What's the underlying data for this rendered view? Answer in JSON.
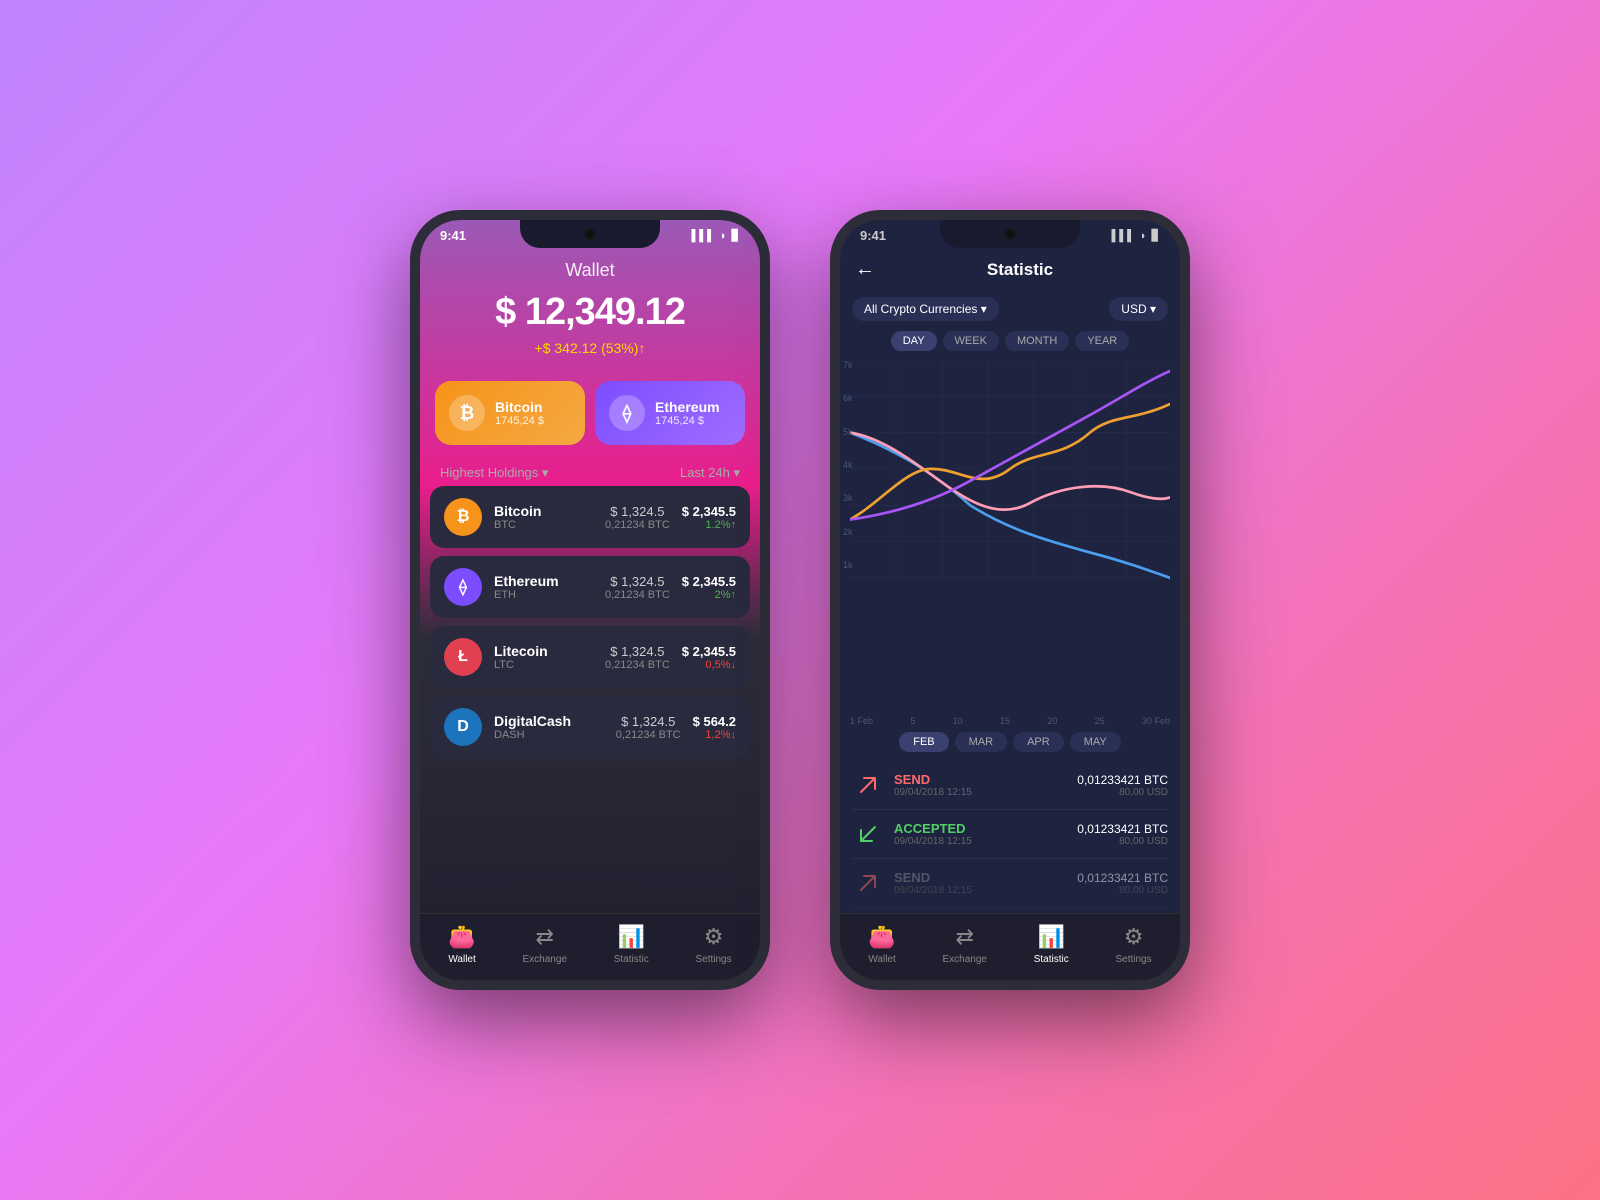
{
  "phone1": {
    "status": {
      "time": "9:41",
      "icons": "▌▌▌ ◗ ▊"
    },
    "header": {
      "title": "Wallet",
      "balance": "$ 12,349.12",
      "change": "+$ 342.12 (53%)↑"
    },
    "cards": [
      {
        "id": "btc",
        "icon": "₿",
        "name": "Bitcoin",
        "amount": "1745,24 $"
      },
      {
        "id": "eth",
        "icon": "⟠",
        "name": "Ethereum",
        "amount": "1745,24 $"
      }
    ],
    "holdings_label": "Highest Holdings ▾",
    "time_label": "Last 24h ▾",
    "holdings": [
      {
        "id": "btc",
        "icon": "₿",
        "name": "Bitcoin",
        "symbol": "BTC",
        "price": "$ 1,324.5",
        "btc": "0,21234 BTC",
        "value": "$ 2,345.5",
        "change": "1.2%↑",
        "up": true
      },
      {
        "id": "eth",
        "icon": "⟠",
        "name": "Ethereum",
        "symbol": "ETH",
        "price": "$ 1,324.5",
        "btc": "0,21234 BTC",
        "value": "$ 2,345.5",
        "change": "2%↑",
        "up": true
      },
      {
        "id": "ltc",
        "icon": "Ł",
        "name": "Litecoin",
        "symbol": "LTC",
        "price": "$ 1,324.5",
        "btc": "0,21234 BTC",
        "value": "$ 2,345.5",
        "change": "0,5%↓",
        "up": false
      },
      {
        "id": "dash",
        "icon": "D",
        "name": "DigitalCash",
        "symbol": "DASH",
        "price": "$ 1,324.5",
        "btc": "0,21234 BTC",
        "value": "$ 564.2",
        "change": "1,2%↓",
        "up": false
      }
    ],
    "nav": [
      {
        "id": "wallet",
        "icon": "👛",
        "label": "Wallet",
        "active": true
      },
      {
        "id": "exchange",
        "icon": "⇄",
        "label": "Exchange",
        "active": false
      },
      {
        "id": "statistic",
        "icon": "📊",
        "label": "Statistic",
        "active": false
      },
      {
        "id": "settings",
        "icon": "⚙",
        "label": "Settings",
        "active": false
      }
    ]
  },
  "phone2": {
    "status": {
      "time": "9:41"
    },
    "header": {
      "back": "←",
      "title": "Statistic"
    },
    "filter_currency": "All Crypto Currencies ▾",
    "filter_usd": "USD ▾",
    "time_tabs": [
      {
        "label": "DAY",
        "active": true
      },
      {
        "label": "WEEK",
        "active": false
      },
      {
        "label": "MONTH",
        "active": false
      },
      {
        "label": "YEAR",
        "active": false
      }
    ],
    "chart": {
      "y_labels": [
        "7k",
        "6k",
        "5k",
        "4k",
        "3k",
        "2k",
        "1k"
      ],
      "x_labels": [
        "1 Feb",
        "5",
        "10",
        "15",
        "20",
        "25",
        "30 Feb"
      ]
    },
    "month_tabs": [
      {
        "label": "FEB",
        "active": true
      },
      {
        "label": "MAR",
        "active": false
      },
      {
        "label": "APR",
        "active": false
      },
      {
        "label": "MAY",
        "active": false
      }
    ],
    "transactions": [
      {
        "type": "SEND",
        "icon": "↗",
        "iconClass": "send",
        "date": "09/04/2018 12:15",
        "btc": "0,01233421 BTC",
        "usd": "80,00 USD",
        "dim": false
      },
      {
        "type": "ACCEPTED",
        "icon": "↙",
        "iconClass": "accepted",
        "date": "09/04/2018 12:15",
        "btc": "0,01233421 BTC",
        "usd": "80,00 USD",
        "dim": false
      },
      {
        "type": "SEND",
        "icon": "↗",
        "iconClass": "send",
        "date": "09/04/2018 12:15",
        "btc": "0,01233421 BTC",
        "usd": "80,00 USD",
        "dim": true
      }
    ],
    "nav": [
      {
        "id": "wallet",
        "icon": "👛",
        "label": "Wallet",
        "active": false
      },
      {
        "id": "exchange",
        "icon": "⇄",
        "label": "Exchange",
        "active": false
      },
      {
        "id": "statistic",
        "icon": "📊",
        "label": "Statistic",
        "active": true
      },
      {
        "id": "settings",
        "icon": "⚙",
        "label": "Settings",
        "active": false
      }
    ]
  }
}
